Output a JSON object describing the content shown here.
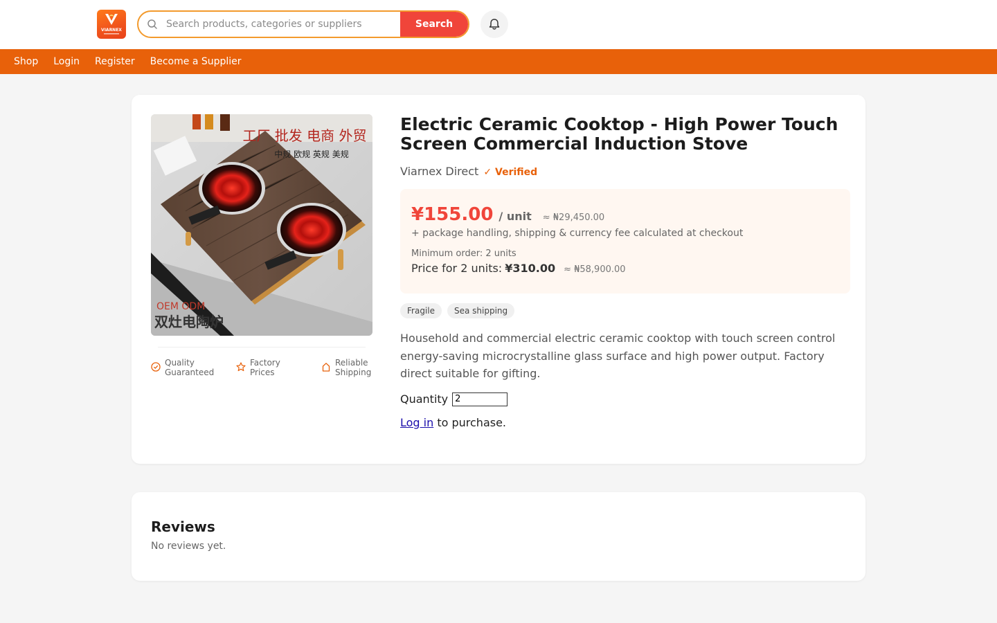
{
  "header": {
    "logo_alt": "VIARNEX",
    "search_placeholder": "Search products, categories or suppliers",
    "search_button": "Search"
  },
  "nav": {
    "items": [
      {
        "label": "Shop"
      },
      {
        "label": "Login"
      },
      {
        "label": "Register"
      },
      {
        "label": "Become a Supplier"
      }
    ]
  },
  "product": {
    "title": "Electric Ceramic Cooktop - High Power Touch Screen Commercial Induction Stove",
    "seller": "Viarnex Direct",
    "verified_label": "Verified",
    "verified_mark": "✓",
    "price": "¥155.00",
    "unit": "/ unit",
    "price_approx": "≈ ₦29,450.00",
    "fees_note": "+ package handling, shipping & currency fee calculated at checkout",
    "min_order": "Minimum order: 2 units",
    "total_label": "Price for 2 units:",
    "total_price": "¥310.00",
    "total_approx": "≈ ₦58,900.00",
    "tags": [
      "Fragile",
      "Sea shipping"
    ],
    "description": "Household and commercial electric ceramic cooktop with touch screen control energy-saving microcrystalline glass surface and high power output. Factory direct suitable for gifting.",
    "quantity_label": "Quantity",
    "quantity_value": "2",
    "login_link": "Log in",
    "login_suffix": " to purchase.",
    "image_text": {
      "headline": "工厂 批发 电商 外贸",
      "subline": "中规 欧规 英规 美规",
      "oem": "OEM ODM",
      "name_cn": "双灶电陶炉"
    },
    "features": [
      {
        "icon": "check-circle-icon",
        "label1": "Quality",
        "label2": "Guaranteed"
      },
      {
        "icon": "star-icon",
        "label1": "Factory",
        "label2": "Prices"
      },
      {
        "icon": "home-icon",
        "label1": "Reliable",
        "label2": "Shipping"
      }
    ]
  },
  "reviews": {
    "title": "Reviews",
    "empty": "No reviews yet."
  },
  "colors": {
    "brand_orange": "#e8610a",
    "price_red": "#f0453a"
  }
}
